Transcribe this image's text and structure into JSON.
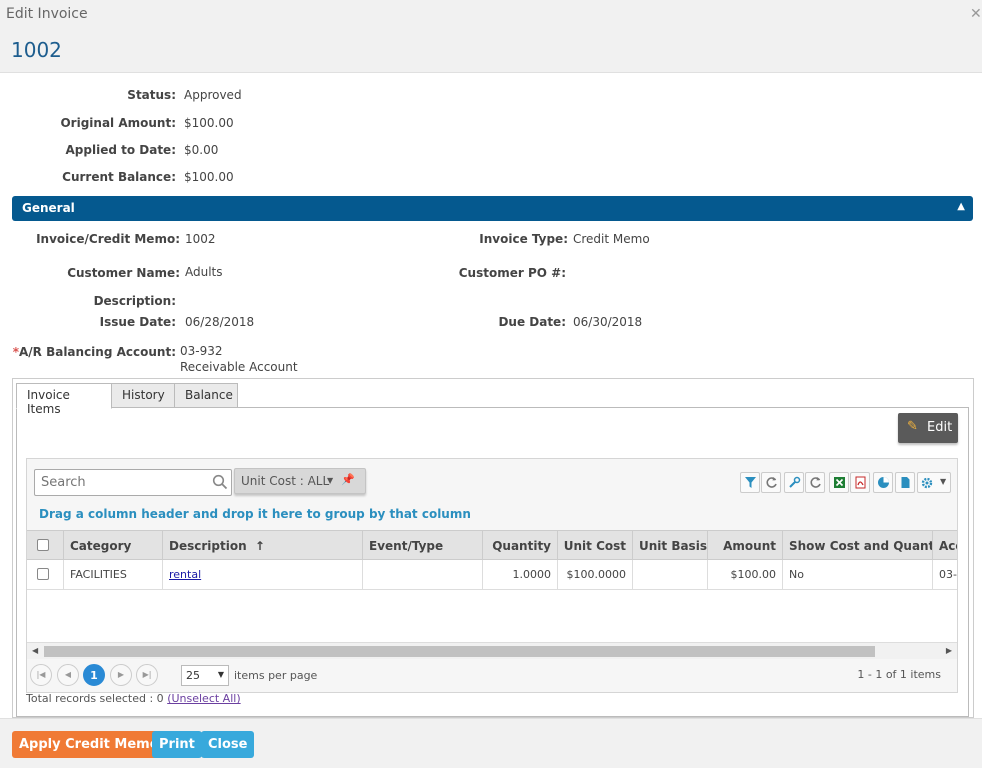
{
  "window": {
    "title": "Edit Invoice",
    "invoice_number": "1002"
  },
  "summary": [
    {
      "label": "Status:",
      "value": "Approved"
    },
    {
      "label": "Original Amount:",
      "value": "$100.00"
    },
    {
      "label": "Applied to Date:",
      "value": "$0.00"
    },
    {
      "label": "Current Balance:",
      "value": "$100.00"
    }
  ],
  "section": {
    "title": "General"
  },
  "general": {
    "invoice_credit_memo": {
      "label": "Invoice/Credit Memo:",
      "value": "1002"
    },
    "invoice_type": {
      "label": "Invoice Type:",
      "value": "Credit Memo"
    },
    "customer_name": {
      "label": "Customer Name:",
      "value": "Adults"
    },
    "customer_po": {
      "label": "Customer PO #:",
      "value": ""
    },
    "description": {
      "label": "Description:",
      "value": ""
    },
    "issue_date": {
      "label": "Issue Date:",
      "value": "06/28/2018"
    },
    "due_date": {
      "label": "Due Date:",
      "value": "06/30/2018"
    },
    "ar_account": {
      "required_mark": "*",
      "label": "A/R Balancing Account:",
      "value": "03-932",
      "subvalue": "Receivable Account"
    }
  },
  "tabs": [
    {
      "label": "Invoice Items",
      "active": true
    },
    {
      "label": "History",
      "active": false
    },
    {
      "label": "Balance",
      "active": false
    }
  ],
  "edit_button": {
    "label": "Edit",
    "icon": "pencil-icon"
  },
  "grid": {
    "search_placeholder": "Search",
    "filter_chip": "Unit Cost : ALL",
    "group_hint": "Drag a column header and drop it here to group by that column",
    "columns": [
      "Category",
      "Description",
      "Event/Type",
      "Quantity",
      "Unit Cost",
      "Unit Basis",
      "Amount",
      "Show Cost and Quant...",
      "Acc"
    ],
    "sort_indicator": "↑",
    "rows": [
      {
        "category": "FACILITIES",
        "description": "rental",
        "event_type": "",
        "quantity": "1.0000",
        "unit_cost": "$100.0000",
        "unit_basis": "",
        "amount": "$100.00",
        "show_cost": "No",
        "account": "03-"
      }
    ],
    "pager": {
      "current_page": "1",
      "page_size": "25",
      "items_per_page_label": "items per page",
      "info": "1 - 1 of 1 items"
    },
    "total_records": "Total records selected : 0",
    "unselect_all": "(Unselect All)"
  },
  "footer": {
    "apply": "Apply Credit Memo",
    "print": "Print",
    "close": "Close"
  },
  "colors": {
    "accent": "#05598f",
    "orange": "#f07a35",
    "blue": "#38a9dc",
    "link_hint": "#2b8fbf"
  }
}
